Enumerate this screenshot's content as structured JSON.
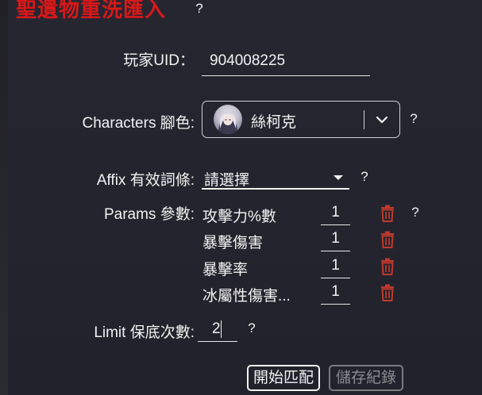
{
  "title": "聖遺物重洗匯入",
  "help_symbol": "?",
  "uid": {
    "label": "玩家UID：",
    "value": "904008225"
  },
  "characters": {
    "label": "Characters 腳色:",
    "selected": "絲柯克",
    "avatar_icon": "character-portrait"
  },
  "affix": {
    "label": "Affix 有效詞條:",
    "selected": "請選擇"
  },
  "params": {
    "label": "Params 參數:",
    "items": [
      {
        "name": "攻擊力%數",
        "value": "1"
      },
      {
        "name": "暴擊傷害",
        "value": "1"
      },
      {
        "name": "暴擊率",
        "value": "1"
      },
      {
        "name": "冰屬性傷害...",
        "value": "1"
      }
    ]
  },
  "limit": {
    "label": "Limit 保底次數:",
    "value": "2"
  },
  "buttons": {
    "start": "開始匹配",
    "save": "儲存紀錄"
  },
  "colors": {
    "background": "#262631",
    "title": "#d91818",
    "trash": "#c0392b",
    "text": "#f2f2f2",
    "disabled": "#8a8a90"
  }
}
